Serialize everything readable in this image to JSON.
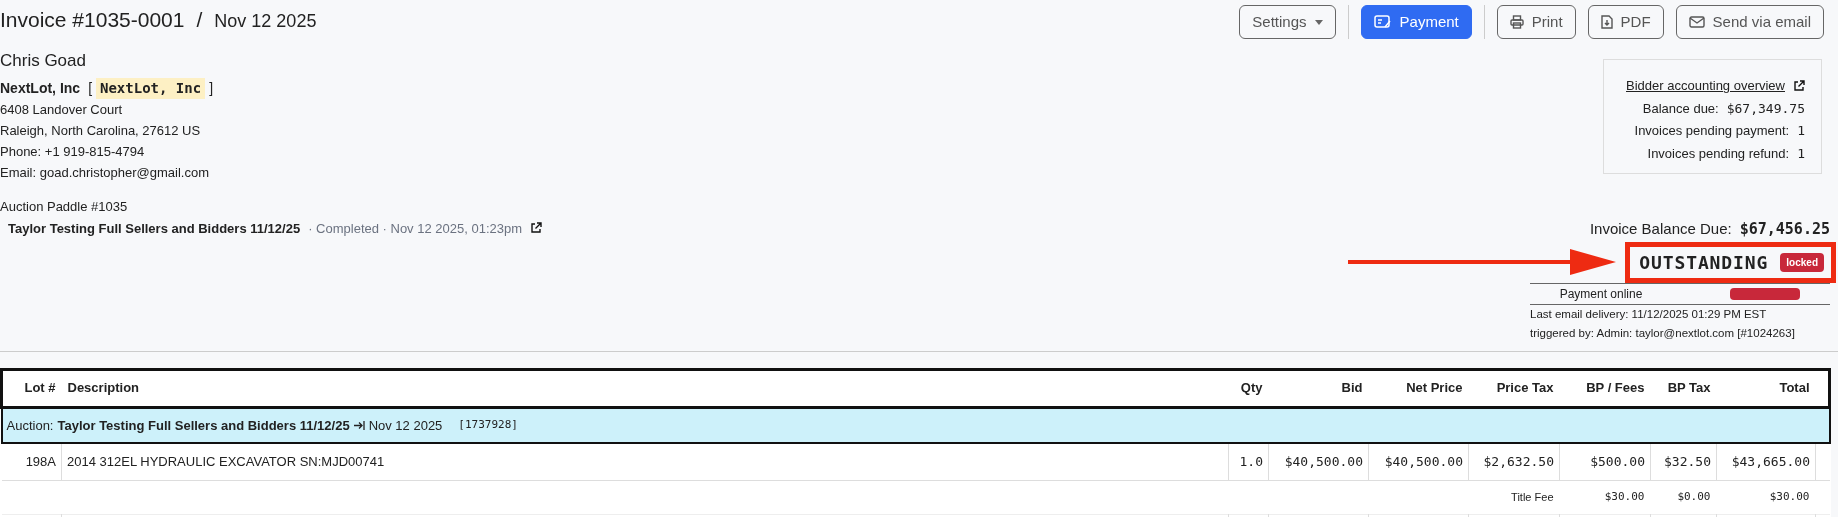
{
  "header": {
    "title": "Invoice #1035-0001",
    "separator": "/",
    "date": "Nov 12 2025"
  },
  "toolbar": [
    {
      "label": "Settings",
      "kind": "dropdown"
    },
    {
      "label": "Payment",
      "kind": "primary"
    },
    {
      "label": "Print",
      "kind": "print"
    },
    {
      "label": "PDF",
      "kind": "pdf"
    },
    {
      "label": "Send via email",
      "kind": "email"
    }
  ],
  "bidder": {
    "name": "Chris Goad",
    "company": "NextLot, Inc",
    "company_tag": "NextLot, Inc",
    "tag_open": "[",
    "tag_close": "]",
    "address_lines": [
      "6408 Landover Court",
      "Raleigh, North Carolina, 27612 US",
      "Phone: +1 919-815-4794",
      "Email: goad.christopher@gmail.com"
    ]
  },
  "auction": {
    "paddle": "Auction Paddle #1035",
    "name": "Taylor Testing Full Sellers and Bidders 11/12/25",
    "status": "· Completed · Nov 12 2025, 01:23pm"
  },
  "account_summary": {
    "link": "Bidder accounting overview",
    "rows": [
      {
        "label": "Balance due:",
        "value": "$67,349.75"
      },
      {
        "label": "Invoices pending payment:",
        "value": "1"
      },
      {
        "label": "Invoices pending refund:",
        "value": "1"
      }
    ]
  },
  "invoice_status": {
    "balance_label": "Invoice Balance Due:",
    "balance": "$67,456.25",
    "status": "OUTSTANDING",
    "locked": true,
    "locked_label": "locked",
    "card_limit": "Payment online",
    "last_email": "Last email delivery: 11/12/2025 01:29 PM EST",
    "triggered_by": "triggered by: Admin: taylor@nextlot.com [#1024263]"
  },
  "table": {
    "columns": [
      "Lot #",
      "Description",
      "Qty",
      "Bid",
      "Net Price",
      "Price Tax",
      "BP / Fees",
      "BP Tax",
      "Total"
    ],
    "group": {
      "prefix": "Auction:",
      "name": "Taylor Testing Full Sellers and Bidders 11/12/25",
      "date": "Nov 12 2025",
      "id": "[1737928]"
    },
    "rows": [
      {
        "kind": "item",
        "cells": [
          "198A",
          "2014 312EL HYDRAULIC EXCAVATOR SN:MJD00741",
          "1.0",
          "$40,500.00",
          "$40,500.00",
          "$2,632.50",
          "$500.00",
          "$32.50",
          "$43,665.00"
        ]
      },
      {
        "kind": "fee",
        "cells": [
          "",
          "",
          "",
          "",
          "",
          "Title Fee",
          "$30.00",
          "$0.00",
          "$30.00"
        ]
      }
    ]
  }
}
